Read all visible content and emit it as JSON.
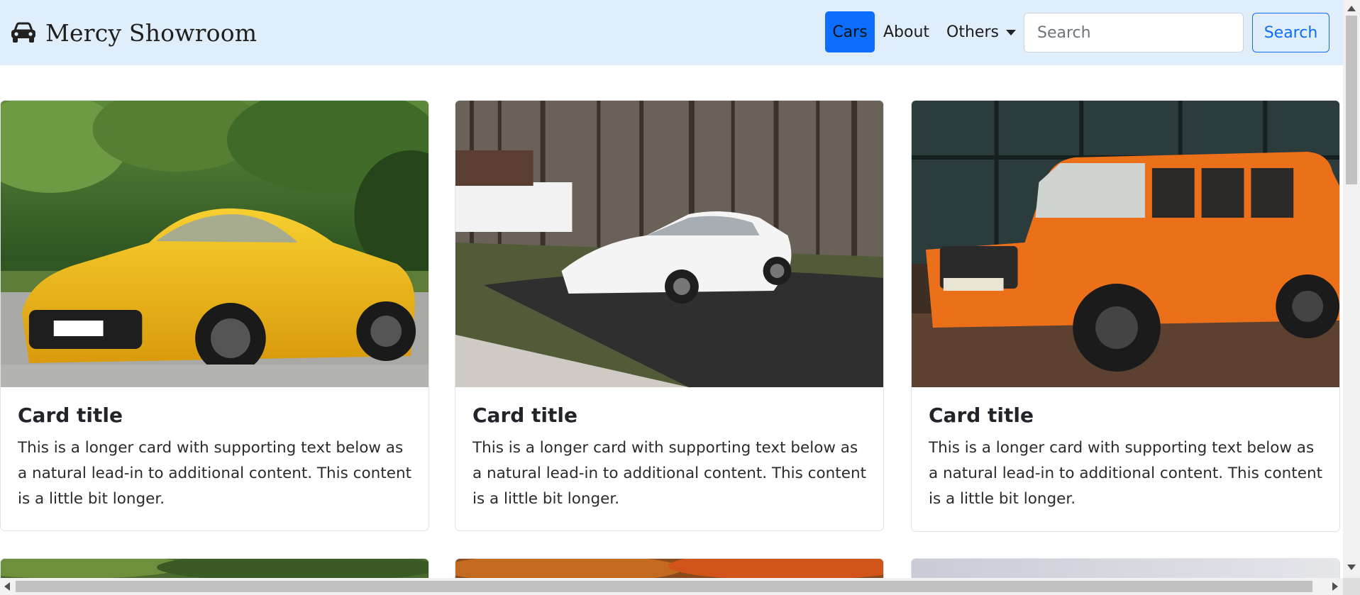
{
  "navbar": {
    "brand_icon": "car-icon",
    "brand": "Mercy Showroom",
    "links": [
      {
        "label": "Cars",
        "active": true
      },
      {
        "label": "About",
        "active": false
      },
      {
        "label": "Others",
        "active": false,
        "dropdown": true
      }
    ],
    "search": {
      "placeholder": "Search",
      "value": "",
      "button_label": "Search"
    },
    "colors": {
      "background": "#e0eefb",
      "active_link_bg": "#0d6efd",
      "search_button": "#0d6efd"
    }
  },
  "cards": [
    {
      "image": "yellow-sports-car-photo",
      "title": "Card title",
      "text": "This is a longer card with supporting text below as a natural lead-in to additional content. This content is a little bit longer."
    },
    {
      "image": "white-sedan-photo",
      "title": "Card title",
      "text": "This is a longer card with supporting text below as a natural lead-in to additional content. This content is a little bit longer."
    },
    {
      "image": "orange-suv-photo",
      "title": "Card title",
      "text": "This is a longer card with supporting text below as a natural lead-in to additional content. This content is a little bit longer."
    }
  ],
  "next_row_images": [
    "green-landscape-photo",
    "autumn-foliage-photo",
    "grey-sky-photo"
  ]
}
